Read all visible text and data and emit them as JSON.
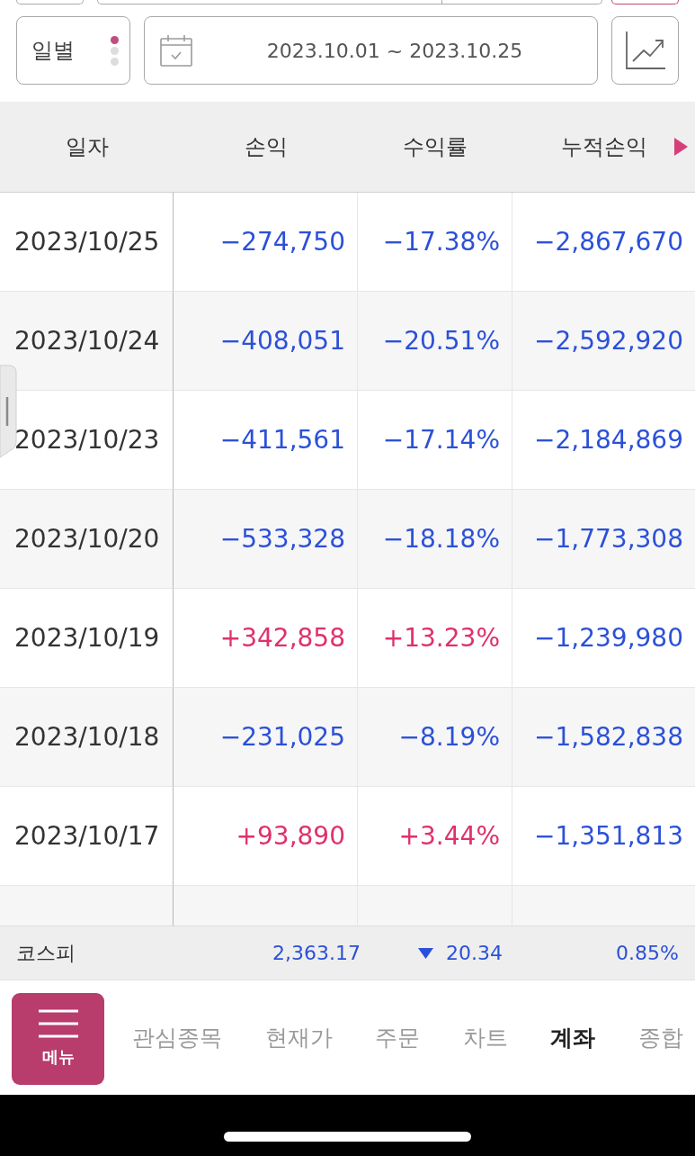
{
  "period_selector": {
    "label": "일별",
    "dots": [
      {
        "selected": true
      },
      {
        "selected": false
      },
      {
        "selected": false
      }
    ]
  },
  "date_range": {
    "value": "2023.10.01 ~ 2023.10.25"
  },
  "table": {
    "columns": [
      {
        "label": "일자"
      },
      {
        "label": "손익"
      },
      {
        "label": "수익률"
      },
      {
        "label": "누적손익"
      }
    ],
    "rows": [
      {
        "date": "2023/10/25",
        "values": [
          {
            "text": "−274,750",
            "gain": false
          },
          {
            "text": "−17.38%",
            "gain": false
          },
          {
            "text": "−2,867,670",
            "gain": false
          }
        ]
      },
      {
        "date": "2023/10/24",
        "values": [
          {
            "text": "−408,051",
            "gain": false
          },
          {
            "text": "−20.51%",
            "gain": false
          },
          {
            "text": "−2,592,920",
            "gain": false
          }
        ]
      },
      {
        "date": "2023/10/23",
        "values": [
          {
            "text": "−411,561",
            "gain": false
          },
          {
            "text": "−17.14%",
            "gain": false
          },
          {
            "text": "−2,184,869",
            "gain": false
          }
        ]
      },
      {
        "date": "2023/10/20",
        "values": [
          {
            "text": "−533,328",
            "gain": false
          },
          {
            "text": "−18.18%",
            "gain": false
          },
          {
            "text": "−1,773,308",
            "gain": false
          }
        ]
      },
      {
        "date": "2023/10/19",
        "values": [
          {
            "text": "+342,858",
            "gain": true
          },
          {
            "text": "+13.23%",
            "gain": true
          },
          {
            "text": "−1,239,980",
            "gain": false
          }
        ]
      },
      {
        "date": "2023/10/18",
        "values": [
          {
            "text": "−231,025",
            "gain": false
          },
          {
            "text": "−8.19%",
            "gain": false
          },
          {
            "text": "−1,582,838",
            "gain": false
          }
        ]
      },
      {
        "date": "2023/10/17",
        "values": [
          {
            "text": "+93,890",
            "gain": true
          },
          {
            "text": "+3.44%",
            "gain": true
          },
          {
            "text": "−1,351,813",
            "gain": false
          }
        ]
      }
    ]
  },
  "market_bar": {
    "name": "코스피",
    "value": "2,363.17",
    "rising": false,
    "change": "20.34",
    "change_rate": "0.85%"
  },
  "menu_button": {
    "label": "메뉴"
  },
  "nav_tabs": [
    {
      "label": "관심종목",
      "selected": false
    },
    {
      "label": "현재가",
      "selected": false
    },
    {
      "label": "주문",
      "selected": false
    },
    {
      "label": "차트",
      "selected": false
    },
    {
      "label": "계좌",
      "selected": true
    },
    {
      "label": "종합",
      "selected": false
    }
  ]
}
